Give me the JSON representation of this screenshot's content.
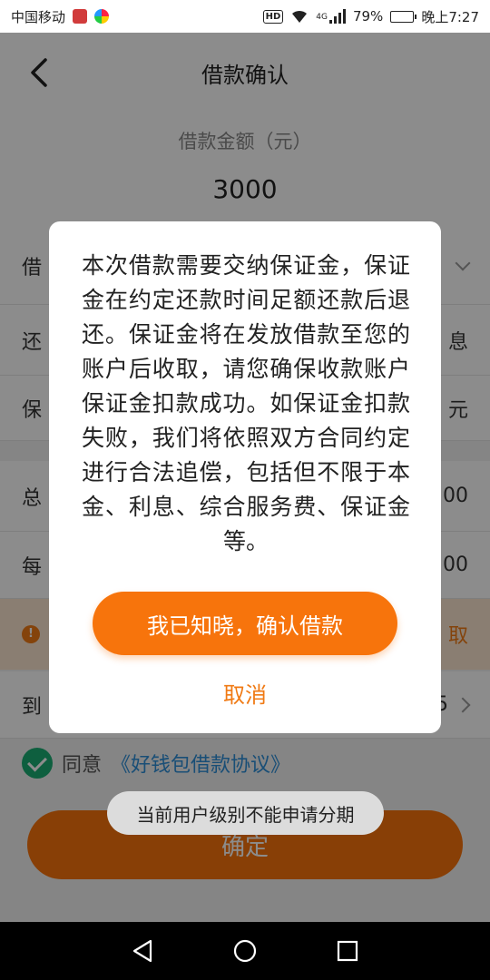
{
  "status_bar": {
    "carrier": "中国移动",
    "hd": "HD",
    "network": "4G",
    "battery": "79%",
    "battery_level": 0.79,
    "time": "晚上7:27"
  },
  "header": {
    "title": "借款确认"
  },
  "amount": {
    "label": "借款金额（元）",
    "value": "3000"
  },
  "rows": [
    {
      "label": "借",
      "value": ""
    },
    {
      "label": "还",
      "value": "息"
    },
    {
      "label": "保",
      "value": "元"
    },
    {
      "label": "总",
      "value": "00"
    },
    {
      "label": "每",
      "value": "00"
    },
    {
      "label": "到",
      "value": "5"
    }
  ],
  "notice": {
    "link": "取"
  },
  "agreement": {
    "prefix": "同意",
    "doc": "《好钱包借款协议》"
  },
  "confirm_button": "确定",
  "dialog": {
    "message": "本次借款需要交纳保证金，保证金在约定还款时间足额还款后退还。保证金将在发放借款至您的账户后收取，请您确保收款账户保证金扣款成功。如保证金扣款失败，我们将依照双方合同约定进行合法追偿，包括但不限于本金、利息、综合服务费、保证金等。",
    "primary_label": "我已知晓，确认借款",
    "cancel_label": "取消"
  },
  "toast": "当前用户级别不能申请分期",
  "colors": {
    "accent": "#f7740c",
    "link": "#2f8fd8",
    "check": "#1aad73"
  }
}
